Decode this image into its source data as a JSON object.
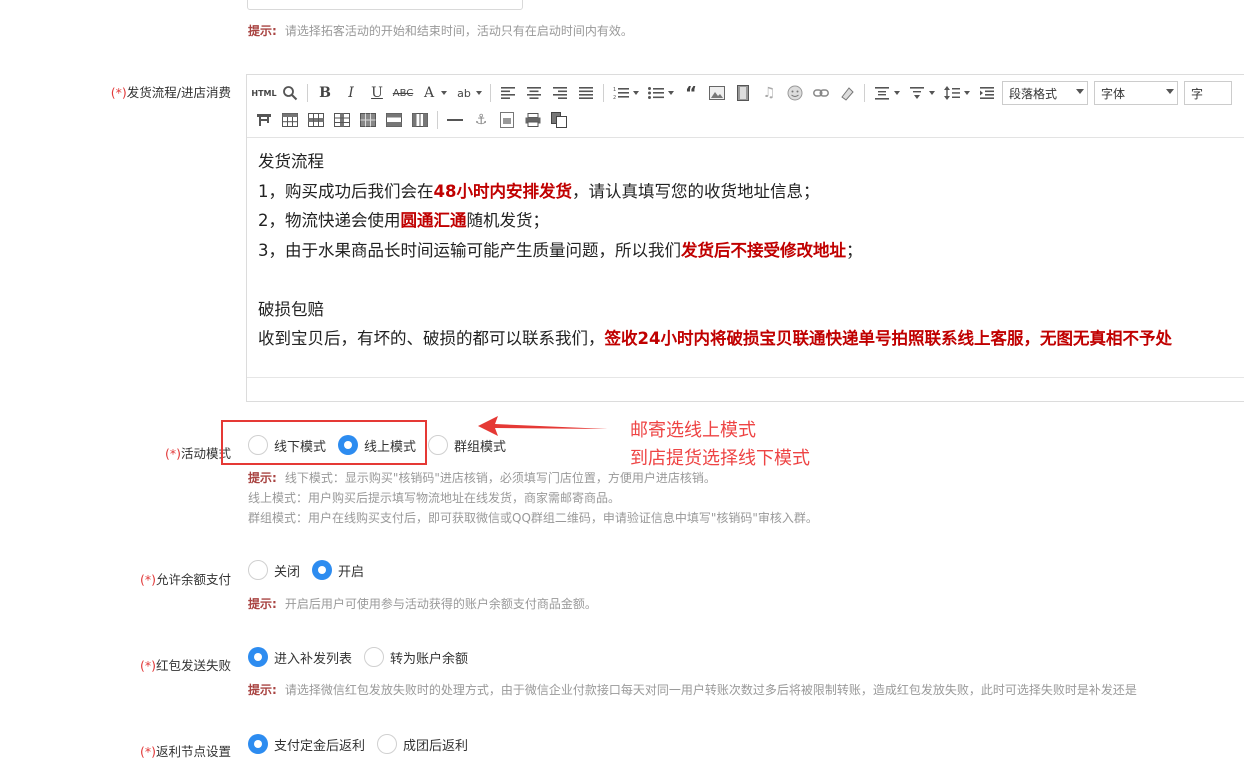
{
  "time_hint": {
    "label": "提示:",
    "text": "请选择拓客活动的开始和结束时间，活动只有在启动时间内有效。"
  },
  "shipping": {
    "required_mark": "(*)",
    "label": "发货流程/进店消费",
    "toolbar": {
      "paragraph_format": "段落格式",
      "font_family": "字体",
      "font_size_partial": "字"
    },
    "content": {
      "heading": "发货流程",
      "line1_pre": "1，购买成功后我们会在",
      "line1_red": "48小时内安排发货",
      "line1_post": "，请认真填写您的收货地址信息；",
      "line2_pre": "2，物流快递会使用",
      "line2_red": "圆通汇通",
      "line2_post": "随机发货；",
      "line3_pre": "3，由于水果商品长时间运输可能产生质量问题，所以我们",
      "line3_red": "发货后不接受修改地址",
      "line3_post": "；",
      "heading2": "破损包赔",
      "line4_pre": "收到宝贝后，有坏的、破损的都可以联系我们，",
      "line4_red": "签收24小时内将破损宝贝联通快递单号拍照联系线上客服，无图无真相不予处"
    }
  },
  "activity_mode": {
    "required_mark": "(*)",
    "label": "活动模式",
    "options": [
      {
        "label": "线下模式",
        "checked": false
      },
      {
        "label": "线上模式",
        "checked": true
      },
      {
        "label": "群组模式",
        "checked": false
      }
    ],
    "hint_label": "提示:",
    "hint_line1": "线下模式：显示购买\"核销码\"进店核销，必须填写门店位置，方便用户进店核销。",
    "hint_line2": "线上模式：用户购买后提示填写物流地址在线发货，商家需邮寄商品。",
    "hint_line3": "群组模式：用户在线购买支付后，即可获取微信或QQ群组二维码，申请验证信息中填写\"核销码\"审核入群。"
  },
  "annotation": {
    "line1": "邮寄选线上模式",
    "line2": "到店提货选择线下模式",
    "color": "#ee4444"
  },
  "balance_pay": {
    "required_mark": "(*)",
    "label": "允许余额支付",
    "options": [
      {
        "label": "关闭",
        "checked": false
      },
      {
        "label": "开启",
        "checked": true
      }
    ],
    "hint_label": "提示:",
    "hint": "开启后用户可使用参与活动获得的账户余额支付商品金额。"
  },
  "red_packet": {
    "required_mark": "(*)",
    "label": "红包发送失败",
    "options": [
      {
        "label": "进入补发列表",
        "checked": true
      },
      {
        "label": "转为账户余额",
        "checked": false
      }
    ],
    "hint_label": "提示:",
    "hint": "请选择微信红包发放失败时的处理方式，由于微信企业付款接口每天对同一用户转账次数过多后将被限制转账，造成红包发放失败，此时可选择失败时是补发还是"
  },
  "rebate_node": {
    "required_mark": "(*)",
    "label": "返利节点设置",
    "options": [
      {
        "label": "支付定金后返利",
        "checked": true
      },
      {
        "label": "成团后返利",
        "checked": false
      }
    ]
  },
  "colors": {
    "accent": "#2d8cf0",
    "required": "#e23a3a",
    "hint_label": "#a94442",
    "highlight_text": "#c00000"
  }
}
